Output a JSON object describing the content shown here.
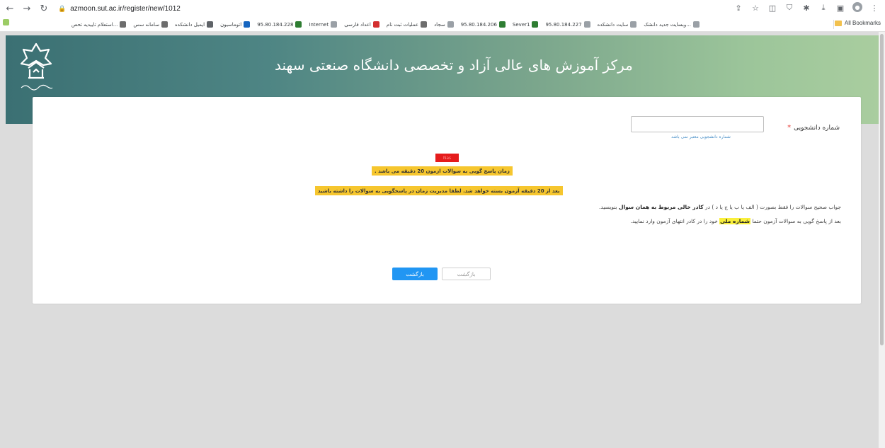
{
  "browser": {
    "url": "azmoon.sut.ac.ir/register/new/1012",
    "bookmarks": [
      {
        "label": "وبسایت جدید دانشک...",
        "color": "#9aa0a6"
      },
      {
        "label": "سایت دانشکده",
        "color": "#9aa0a6"
      },
      {
        "label": "95.80.184.227",
        "color": "#9aa0a6"
      },
      {
        "label": "Sever1",
        "color": "#2e7d32"
      },
      {
        "label": "95.80.184.206",
        "color": "#2e7d32"
      },
      {
        "label": "سجاد",
        "color": "#9aa0a6"
      },
      {
        "label": "عملیات ثبت نام",
        "color": "#6d6d6d"
      },
      {
        "label": "اعداد فارسی",
        "color": "#d32f2f"
      },
      {
        "label": "Internet",
        "color": "#9aa0a6"
      },
      {
        "label": "95.80.184.228",
        "color": "#2e7d32"
      },
      {
        "label": "اتوماسیون",
        "color": "#1565c0"
      },
      {
        "label": "ایمیل دانشکده",
        "color": "#5f6368"
      },
      {
        "label": "سامانه سس",
        "color": "#6d6d6d"
      },
      {
        "label": "استعلام تاییدیه تحص...",
        "color": "#6d6d6d"
      }
    ],
    "all_bookmarks": "All Bookmarks",
    "left_bookmark_icon": "BR"
  },
  "header": {
    "title": "مرکز آموزش های عالی آزاد و تخصصی دانشگاه صنعتی سهند"
  },
  "form": {
    "student_id_label": "شماره دانشجویی",
    "required_mark": "*",
    "student_id_value": "",
    "student_id_hint": "شماره دانشجویی معتبر نمی باشد",
    "red_tag": "Nas",
    "notice_time": "زمان پاسخ گویی به سوالات ازمون 20 دقیقه می باشد .",
    "notice_close": "بعد از 20 دقیقه آزمون بسته خواهد شد. لطفا مدیریت زمان در پاسخگویی به سوالات را داشته باشید",
    "instruction_1_pre": "جواب صحیح سوالات را فقط بصورت ( الف یا ب یا ج یا د ) در ",
    "instruction_1_bold": "کادر خالی مربوط به همان سوال",
    "instruction_1_post": " بنویسید.",
    "instruction_2_pre": "بعد از پاسخ گویی به سوالات آزمون حتما ",
    "instruction_2_highlight": "شماره ملی",
    "instruction_2_post": " خود را در کادر انتهای آزمون وارد نمایید.",
    "primary_button": "بازگشت",
    "secondary_button": "بازگشت"
  }
}
